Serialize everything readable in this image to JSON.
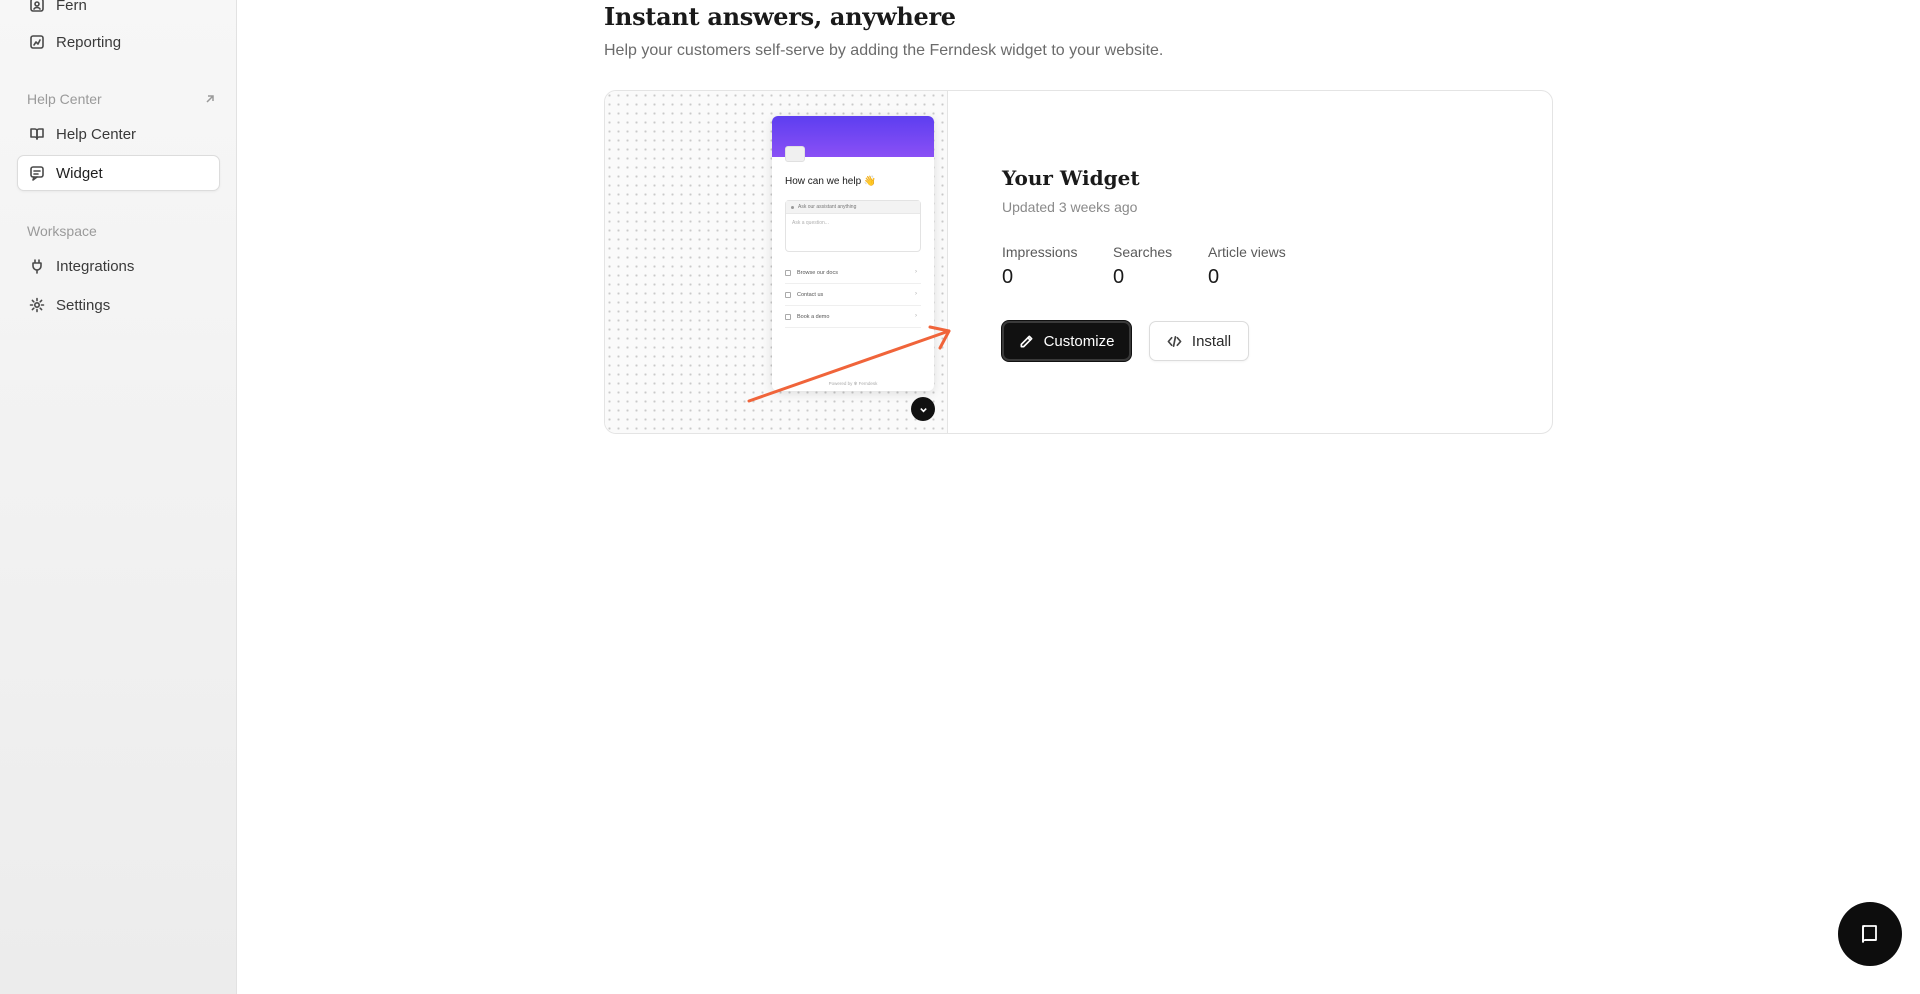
{
  "sidebar": {
    "items": [
      {
        "label": "Fern",
        "icon": "contact-icon"
      },
      {
        "label": "Reporting",
        "icon": "chart-icon"
      },
      {
        "label": "Help Center",
        "icon": "book-icon"
      },
      {
        "label": "Widget",
        "icon": "chat-icon",
        "active": true
      },
      {
        "label": "Integrations",
        "icon": "plug-icon"
      },
      {
        "label": "Settings",
        "icon": "gear-icon"
      }
    ],
    "sections": {
      "help_center": "Help Center",
      "workspace": "Workspace"
    }
  },
  "main": {
    "title": "Instant answers, anywhere",
    "subtitle": "Help your customers self-serve by adding the Ferndesk widget to your website.",
    "card": {
      "name": "Your Widget",
      "updated": "Updated 3 weeks ago",
      "stats": [
        {
          "label": "Impressions",
          "value": "0"
        },
        {
          "label": "Searches",
          "value": "0"
        },
        {
          "label": "Article views",
          "value": "0"
        }
      ],
      "customize_label": "Customize",
      "install_label": "Install",
      "preview": {
        "title": "How can we help 👋",
        "assistant": "Ask our assistant anything",
        "placeholder": "Ask a question...",
        "rows": [
          "Browse our docs",
          "Contact us",
          "Book a demo"
        ],
        "footer": "Powered by ✻ Ferndesk"
      }
    }
  },
  "colors": {
    "accent": "#111111",
    "arrow": "#f0643a",
    "widget_header_start": "#5d3ef0",
    "widget_header_end": "#8a50f5"
  }
}
